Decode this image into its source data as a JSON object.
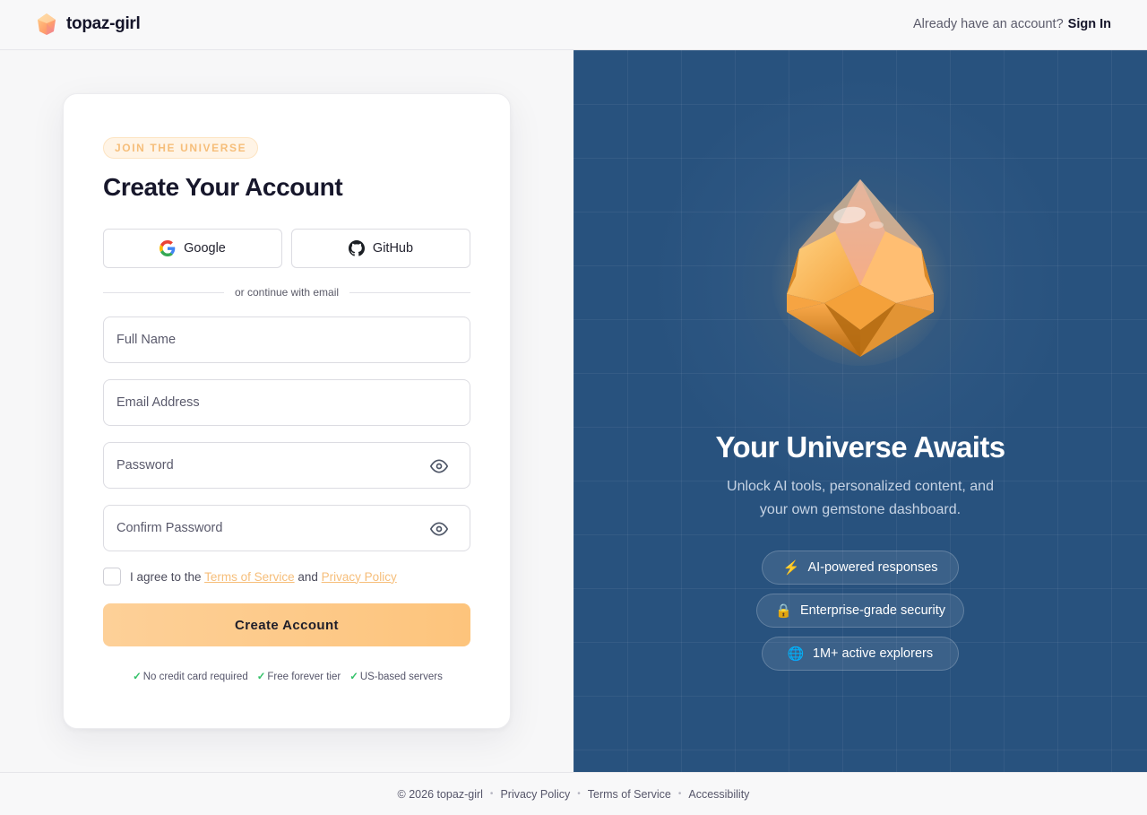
{
  "header": {
    "brand_name": "topaz-girl",
    "prompt_text": "Already have an account?",
    "signin_label": "Sign In"
  },
  "form": {
    "eyebrow": "JOIN THE UNIVERSE",
    "title": "Create Your Account",
    "google_label": "Google",
    "github_label": "GitHub",
    "divider_text": "or continue with email",
    "fields": {
      "full_name": {
        "value": "",
        "placeholder": "Full Name"
      },
      "email": {
        "value": "",
        "placeholder": "Email Address"
      },
      "password": {
        "value": "",
        "placeholder": "Password"
      },
      "confirm_password": {
        "value": "",
        "placeholder": "Confirm Password"
      }
    },
    "agree_checked": false,
    "agree_prefix": "I agree to the",
    "terms_link": "Terms of Service",
    "agree_and": "and",
    "privacy_link": "Privacy Policy",
    "submit_label": "Create Account",
    "perks": [
      "No credit card required",
      "Free forever tier",
      "US-based servers"
    ],
    "perk_check": "✓"
  },
  "hero": {
    "title": "Your Universe Awaits",
    "subtitle": "Unlock AI tools, personalized content, and your own gemstone dashboard.",
    "features": [
      {
        "icon": "bolt-icon",
        "glyph": "⚡",
        "label": "AI-powered responses"
      },
      {
        "icon": "lock-icon",
        "glyph": "🔒",
        "label": "Enterprise-grade security"
      },
      {
        "icon": "globe-icon",
        "glyph": "🌐",
        "label": "1M+ active explorers"
      }
    ]
  },
  "footer": {
    "copyright": "© 2026 topaz-girl",
    "links": [
      "Privacy Policy",
      "Terms of Service",
      "Accessibility"
    ],
    "separator": "•"
  },
  "colors": {
    "accent": "#fdc47c",
    "accent_text": "#f6be7a",
    "hero_bg": "#28527e",
    "check_green": "#35c26a"
  }
}
